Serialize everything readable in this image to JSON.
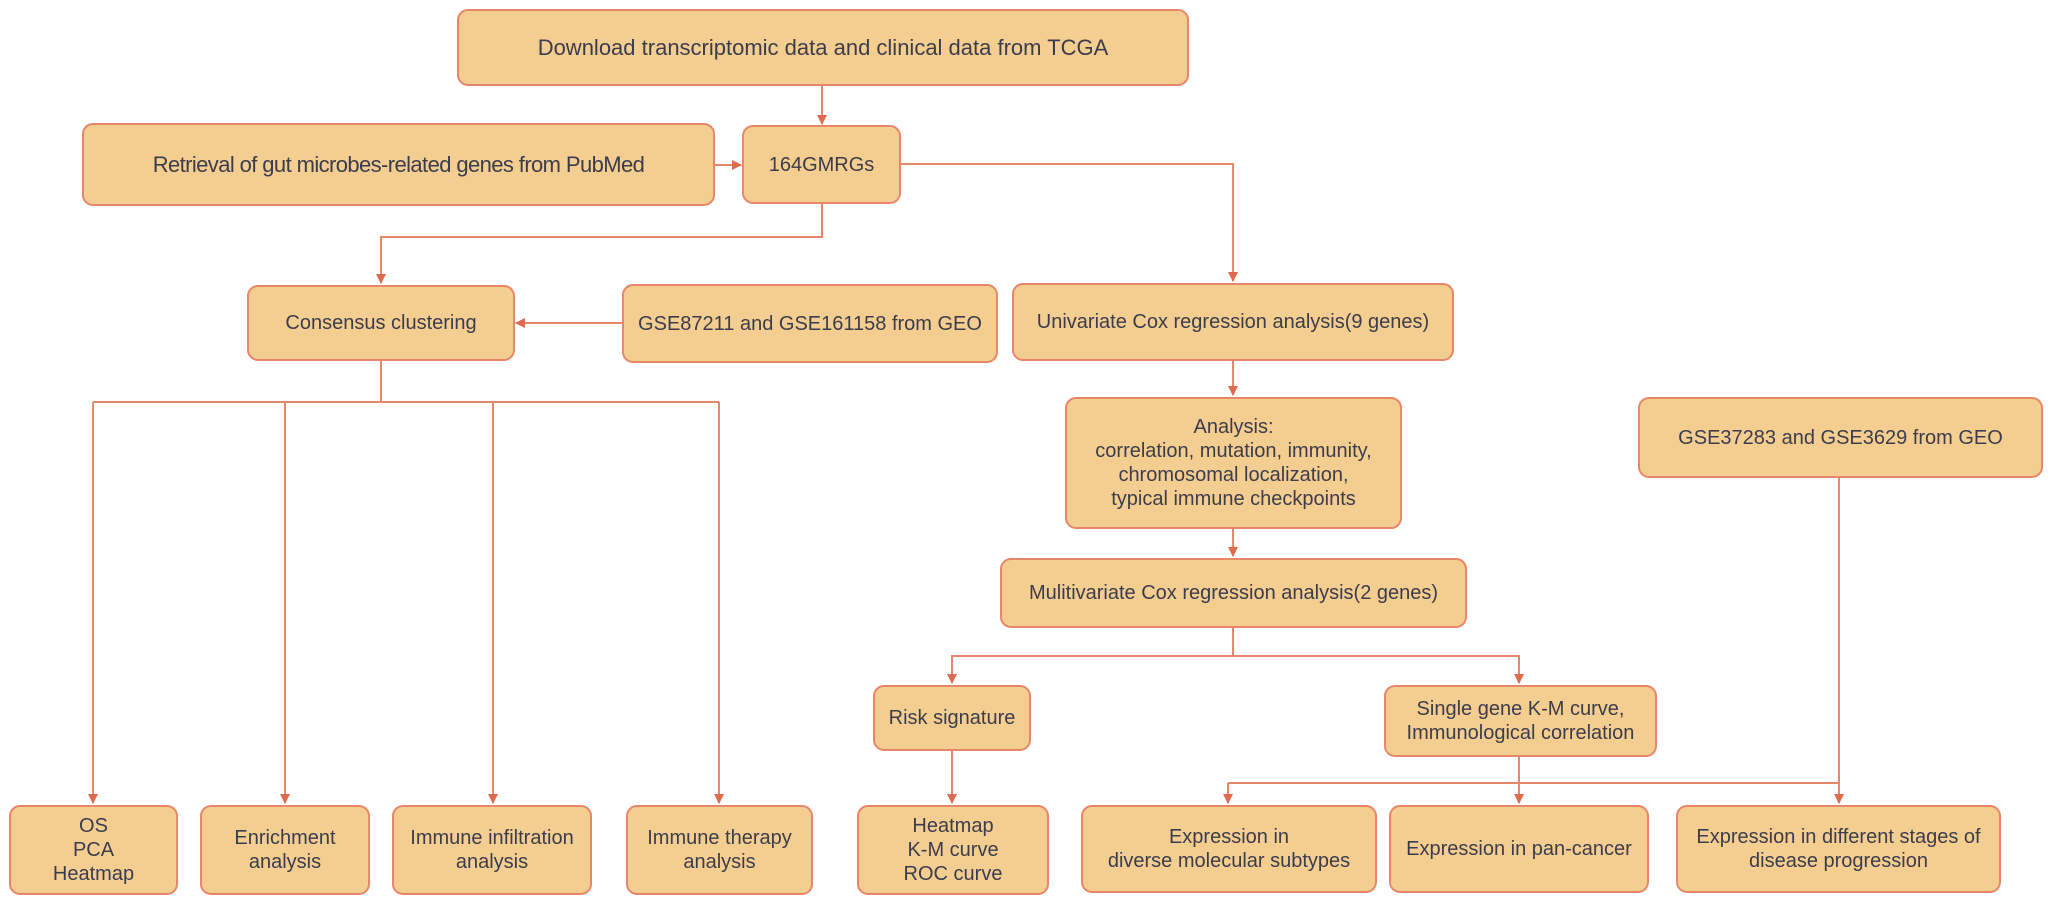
{
  "diagram": {
    "colors": {
      "box_fill": "#F4CD90",
      "box_border": "#E8866A",
      "connector": "#E8866A",
      "text": "#3C3D4C"
    },
    "nodes": {
      "tcga": "Download transcriptomic data and clinical data from TCGA",
      "pubmed": "Retrieval of gut microbes-related genes from PubMed",
      "gmrgs": "164GMRGs",
      "consensus": "Consensus clustering",
      "geo_cluster": "GSE87211 and GSE161158 from GEO",
      "univariate": "Univariate Cox regression analysis(9 genes)",
      "analysis": "Analysis:\ncorrelation, mutation, immunity,\nchromosomal localization,\ntypical immune checkpoints",
      "geo_stage": "GSE37283 and GSE3629 from GEO",
      "multivariate": "Mulitivariate Cox regression analysis(2 genes)",
      "risk": "Risk signature",
      "single_gene": "Single gene K-M curve,\nImmunological correlation",
      "os_pca": "OS\nPCA\nHeatmap",
      "enrichment": "Enrichment\nanalysis",
      "infiltration": "Immune infiltration\nanalysis",
      "therapy": "Immune therapy\nanalysis",
      "risk_outputs": "Heatmap\nK-M curve\nROC curve",
      "subtypes": "Expression in\ndiverse molecular subtypes",
      "pancancer": "Expression in pan-cancer",
      "stages": "Expression in different stages of\ndisease progression"
    },
    "edges": [
      {
        "from": "tcga",
        "to": "gmrgs"
      },
      {
        "from": "pubmed",
        "to": "gmrgs"
      },
      {
        "from": "gmrgs",
        "to": "consensus"
      },
      {
        "from": "gmrgs",
        "to": "univariate"
      },
      {
        "from": "geo_cluster",
        "to": "consensus"
      },
      {
        "from": "consensus",
        "to": "os_pca"
      },
      {
        "from": "consensus",
        "to": "enrichment"
      },
      {
        "from": "consensus",
        "to": "infiltration"
      },
      {
        "from": "consensus",
        "to": "therapy"
      },
      {
        "from": "univariate",
        "to": "analysis"
      },
      {
        "from": "analysis",
        "to": "multivariate"
      },
      {
        "from": "multivariate",
        "to": "risk"
      },
      {
        "from": "multivariate",
        "to": "single_gene"
      },
      {
        "from": "risk",
        "to": "risk_outputs"
      },
      {
        "from": "single_gene",
        "to": "subtypes"
      },
      {
        "from": "single_gene",
        "to": "pancancer"
      },
      {
        "from": "single_gene",
        "to": "stages"
      },
      {
        "from": "geo_stage",
        "to": "stages"
      }
    ]
  }
}
